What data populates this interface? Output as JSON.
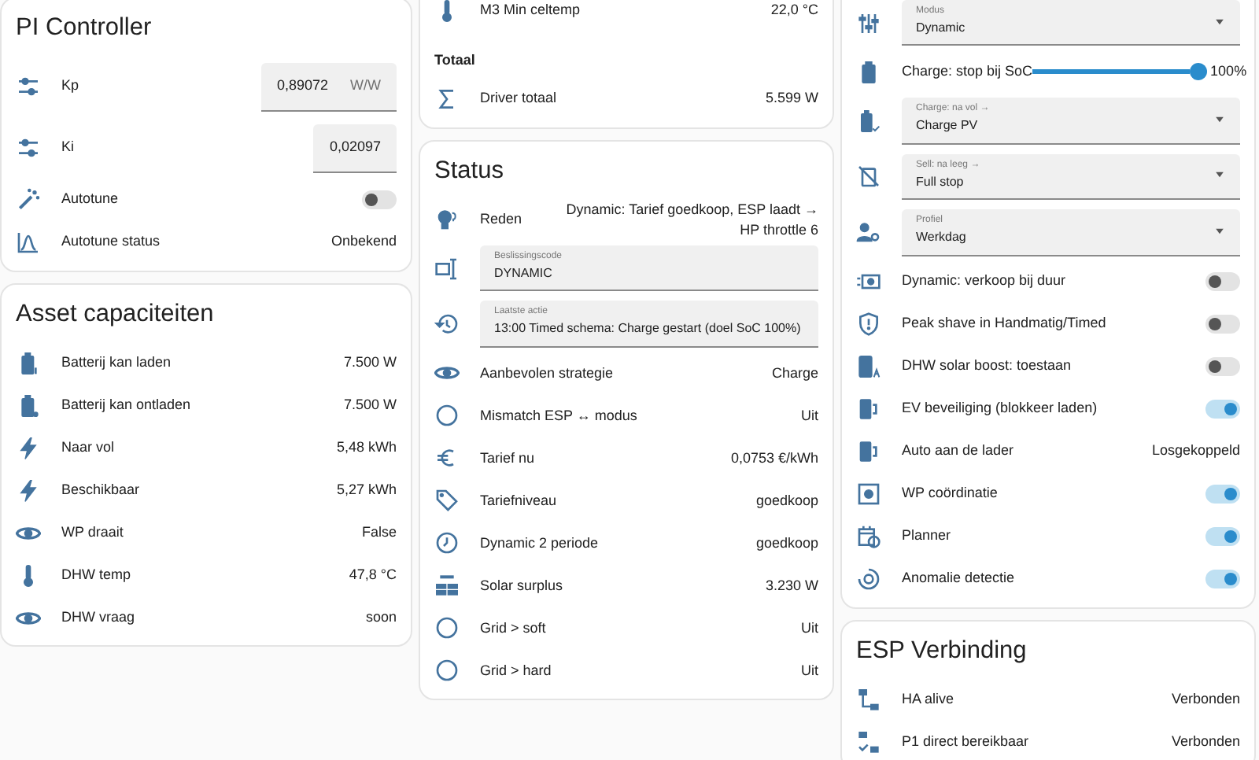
{
  "columns": [
    {
      "cards": [
        {
          "title": "PI Controller",
          "rows": [
            {
              "kind": "number",
              "label": "Kp",
              "value": "0,89072",
              "unit": "W/W"
            },
            {
              "kind": "number",
              "label": "Ki",
              "value": "0,02097"
            },
            {
              "kind": "toggle",
              "label": "Autotune",
              "on": false
            },
            {
              "kind": "sensor",
              "label": "Autotune status",
              "value": "Onbekend"
            }
          ]
        },
        {
          "title": "Asset capaciteiten",
          "rows": [
            {
              "kind": "sensor",
              "label": "Batterij kan laden",
              "value": "7.500 W"
            },
            {
              "kind": "sensor",
              "label": "Batterij kan ontladen",
              "value": "7.500 W"
            },
            {
              "kind": "sensor",
              "label": "Naar vol",
              "value": "5,48 kWh"
            },
            {
              "kind": "sensor",
              "label": "Beschikbaar",
              "value": "5,27 kWh"
            },
            {
              "kind": "sensor",
              "label": "WP draait",
              "value": "False"
            },
            {
              "kind": "sensor",
              "label": "DHW temp",
              "value": "47,8 °C"
            },
            {
              "kind": "sensor",
              "label": "DHW vraag",
              "value": "soon"
            }
          ]
        }
      ]
    },
    {
      "cards": [
        {
          "rows": [
            {
              "kind": "sensor",
              "label": "M3 Min celtemp",
              "value": "22,0 °C"
            },
            {
              "kind": "section",
              "label": "Totaal"
            },
            {
              "kind": "sensor",
              "label": "Driver totaal",
              "value": "5.599 W"
            }
          ]
        },
        {
          "title": "Status",
          "rows": [
            {
              "kind": "sensor",
              "label": "Reden",
              "value": "Dynamic: Tarief goedkoop, ESP laadt → HP throttle 6"
            },
            {
              "kind": "text",
              "label": "Beslissingscode",
              "value": "DYNAMIC"
            },
            {
              "kind": "text",
              "label": "Laatste actie",
              "value": "13:00 Timed schema: Charge gestart (doel SoC 100%)"
            },
            {
              "kind": "sensor",
              "label": "Aanbevolen strategie",
              "value": "Charge"
            },
            {
              "kind": "sensor",
              "label": "Mismatch ESP ↔ modus",
              "value": "Uit"
            },
            {
              "kind": "sensor",
              "label": "Tarief nu",
              "value": "0,0753 €/kWh"
            },
            {
              "kind": "sensor",
              "label": "Tariefniveau",
              "value": "goedkoop"
            },
            {
              "kind": "sensor",
              "label": "Dynamic 2 periode",
              "value": "goedkoop"
            },
            {
              "kind": "sensor",
              "label": "Solar surplus",
              "value": "3.230 W"
            },
            {
              "kind": "sensor",
              "label": "Grid > soft",
              "value": "Uit"
            },
            {
              "kind": "sensor",
              "label": "Grid > hard",
              "value": "Uit"
            }
          ]
        }
      ]
    },
    {
      "cards": [
        {
          "rows": [
            {
              "kind": "select",
              "label": "Modus",
              "value": "Dynamic"
            },
            {
              "kind": "slider",
              "label": "Charge: stop bij SoC",
              "level": 1.0,
              "reading": "100%"
            },
            {
              "kind": "select",
              "label": "Charge: na vol →",
              "value": "Charge PV"
            },
            {
              "kind": "select",
              "label": "Sell: na leeg →",
              "value": "Full stop"
            },
            {
              "kind": "select",
              "label": "Profiel",
              "value": "Werkdag"
            },
            {
              "kind": "toggle",
              "label": "Dynamic: verkoop bij duur",
              "on": false
            },
            {
              "kind": "toggle",
              "label": "Peak shave in Handmatig/Timed",
              "on": false
            },
            {
              "kind": "toggle",
              "label": "DHW solar boost: toestaan",
              "on": false
            },
            {
              "kind": "toggle",
              "label": "EV beveiliging (blokkeer laden)",
              "on": true
            },
            {
              "kind": "sensor",
              "label": "Auto aan de lader",
              "value": "Losgekoppeld"
            },
            {
              "kind": "toggle",
              "label": "WP coördinatie",
              "on": true
            },
            {
              "kind": "toggle",
              "label": "Planner",
              "on": true
            },
            {
              "kind": "toggle",
              "label": "Anomalie detectie",
              "on": true
            }
          ]
        },
        {
          "title": "ESP Verbinding",
          "rows": [
            {
              "kind": "sensor",
              "label": "HA alive",
              "value": "Verbonden"
            },
            {
              "kind": "sensor",
              "label": "P1 direct bereikbaar",
              "value": "Verbonden"
            }
          ]
        }
      ]
    }
  ]
}
